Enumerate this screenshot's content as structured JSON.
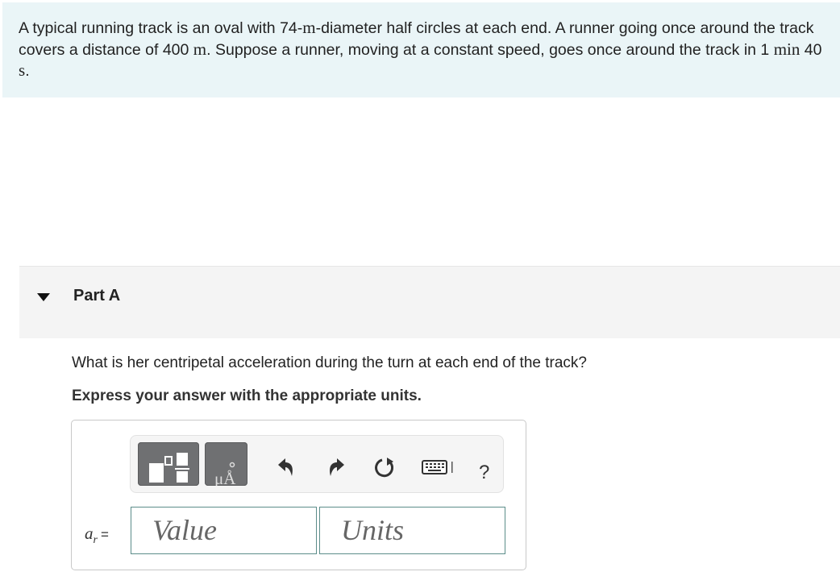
{
  "problem": {
    "t1": "A typical running track is an oval with 74-",
    "m1": "m",
    "t2": "-diameter half circles at each end. A runner going once around the track covers a distance of 400 ",
    "m2": "m",
    "t3": ". Suppose a runner, moving at a constant speed, goes once around the track in 1 ",
    "m3": "min",
    "t4": " 40 ",
    "m4": "s",
    "t5": "."
  },
  "part": {
    "title": "Part A"
  },
  "question": "What is her centripetal acceleration during the turn at each end of the track?",
  "instruction": "Express your answer with the appropriate units.",
  "answer": {
    "variable": "a",
    "subscript": "r",
    "equals": "=",
    "value_placeholder": "Value",
    "units_placeholder": "Units"
  },
  "toolbar": {
    "units_btn_glyph": "μÅ",
    "help_label": "?"
  },
  "icons": [
    "templates-icon",
    "units-icon",
    "undo-icon",
    "redo-icon",
    "reset-icon",
    "keyboard-icon",
    "help-icon"
  ],
  "colors": {
    "problem_bg": "#eaf5f7",
    "field_border": "#5c8d8a",
    "tool_btn": "#6f7072"
  }
}
